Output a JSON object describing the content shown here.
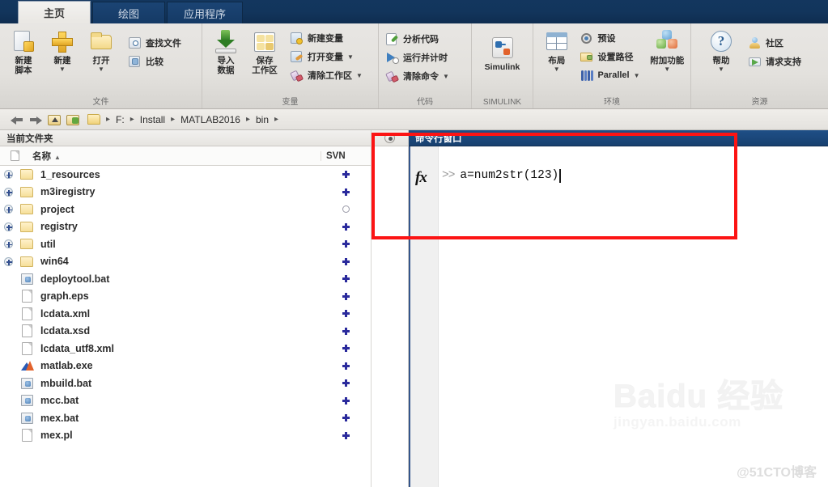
{
  "tabs": [
    {
      "label": "主页",
      "active": true
    },
    {
      "label": "绘图",
      "active": false
    },
    {
      "label": "应用程序",
      "active": false
    }
  ],
  "ribbon": {
    "groups": [
      {
        "name": "file",
        "label": "文件",
        "big": [
          {
            "label_line1": "新建",
            "label_line2": "脚本",
            "icon": "new-script-icon",
            "caret": false
          },
          {
            "label_line1": "新建",
            "label_line2": "",
            "icon": "new-icon",
            "caret": true
          },
          {
            "label_line1": "打开",
            "label_line2": "",
            "icon": "open-folder-icon",
            "caret": true
          }
        ],
        "small": [
          {
            "label": "查找文件",
            "icon": "find-files-icon",
            "caret": false
          },
          {
            "label": "比较",
            "icon": "compare-icon",
            "caret": false
          }
        ]
      },
      {
        "name": "variable",
        "label": "变量",
        "big": [
          {
            "label_line1": "导入",
            "label_line2": "数据",
            "icon": "import-data-icon",
            "caret": false
          },
          {
            "label_line1": "保存",
            "label_line2": "工作区",
            "icon": "save-workspace-icon",
            "caret": false
          }
        ],
        "small": [
          {
            "label": "新建变量",
            "icon": "new-variable-icon",
            "caret": false
          },
          {
            "label": "打开变量",
            "icon": "open-variable-icon",
            "caret": true
          },
          {
            "label": "清除工作区",
            "icon": "clear-workspace-icon",
            "caret": true
          }
        ]
      },
      {
        "name": "code",
        "label": "代码",
        "big": [],
        "small": [
          {
            "label": "分析代码",
            "icon": "analyze-code-icon",
            "caret": false
          },
          {
            "label": "运行并计时",
            "icon": "run-and-time-icon",
            "caret": false
          },
          {
            "label": "清除命令",
            "icon": "clear-commands-icon",
            "caret": true
          }
        ]
      },
      {
        "name": "simulink",
        "label": "SIMULINK",
        "big": [
          {
            "label_line1": "Simulink",
            "label_line2": "",
            "icon": "simulink-icon",
            "caret": false
          }
        ],
        "small": []
      },
      {
        "name": "environment",
        "label": "环境",
        "big": [
          {
            "label_line1": "布局",
            "label_line2": "",
            "icon": "layout-icon",
            "caret": true
          }
        ],
        "small": [
          {
            "label": "预设",
            "icon": "preferences-icon",
            "caret": false
          },
          {
            "label": "设置路径",
            "icon": "set-path-icon",
            "caret": false
          },
          {
            "label": "Parallel",
            "icon": "parallel-icon",
            "caret": true
          }
        ],
        "big2": [
          {
            "label_line1": "附加功能",
            "label_line2": "",
            "icon": "add-ons-icon",
            "caret": true
          }
        ]
      },
      {
        "name": "resources",
        "label": "资源",
        "big": [
          {
            "label_line1": "帮助",
            "label_line2": "",
            "icon": "help-icon",
            "caret": true
          }
        ],
        "small": [
          {
            "label": "社区",
            "icon": "community-icon",
            "caret": false
          },
          {
            "label": "请求支持",
            "icon": "request-support-icon",
            "caret": false
          }
        ]
      }
    ]
  },
  "addressbar": {
    "back_icon": "back-arrow-icon",
    "forward_icon": "forward-arrow-icon",
    "up_icon": "up-folder-icon",
    "refresh_icon": "browse-folder-icon",
    "crumbs": [
      "F:",
      "Install",
      "MATLAB2016",
      "bin"
    ],
    "separator": "▸"
  },
  "current_folder": {
    "panel_title": "当前文件夹",
    "columns": {
      "name": "名称",
      "sort": "▲",
      "svn": "SVN"
    },
    "rows": [
      {
        "name": "1_resources",
        "type": "folder",
        "expandable": true,
        "svn": "plus"
      },
      {
        "name": "m3iregistry",
        "type": "folder",
        "expandable": true,
        "svn": "plus"
      },
      {
        "name": "project",
        "type": "folder",
        "expandable": true,
        "svn": "circle"
      },
      {
        "name": "registry",
        "type": "folder",
        "expandable": true,
        "svn": "plus"
      },
      {
        "name": "util",
        "type": "folder",
        "expandable": true,
        "svn": "plus"
      },
      {
        "name": "win64",
        "type": "folder",
        "expandable": true,
        "svn": "plus"
      },
      {
        "name": "deploytool.bat",
        "type": "bat",
        "expandable": false,
        "svn": "plus"
      },
      {
        "name": "graph.eps",
        "type": "file",
        "expandable": false,
        "svn": "plus"
      },
      {
        "name": "lcdata.xml",
        "type": "file",
        "expandable": false,
        "svn": "plus"
      },
      {
        "name": "lcdata.xsd",
        "type": "file",
        "expandable": false,
        "svn": "plus"
      },
      {
        "name": "lcdata_utf8.xml",
        "type": "file",
        "expandable": false,
        "svn": "plus"
      },
      {
        "name": "matlab.exe",
        "type": "matlab",
        "expandable": false,
        "svn": "plus"
      },
      {
        "name": "mbuild.bat",
        "type": "bat",
        "expandable": false,
        "svn": "plus"
      },
      {
        "name": "mcc.bat",
        "type": "bat",
        "expandable": false,
        "svn": "plus"
      },
      {
        "name": "mex.bat",
        "type": "bat",
        "expandable": false,
        "svn": "plus"
      },
      {
        "name": "mex.pl",
        "type": "file",
        "expandable": false,
        "svn": "plus"
      }
    ]
  },
  "command_window": {
    "title": "命令行窗口",
    "fx_label": "fx",
    "prompt": ">>",
    "input_value": "a=num2str(123)"
  },
  "annotation": {
    "highlight_color": "#fc1414"
  },
  "watermarks": {
    "baidu_main": "Baidu 经验",
    "baidu_sub": "jingyan.baidu.com",
    "cto": "@51CTO博客"
  }
}
